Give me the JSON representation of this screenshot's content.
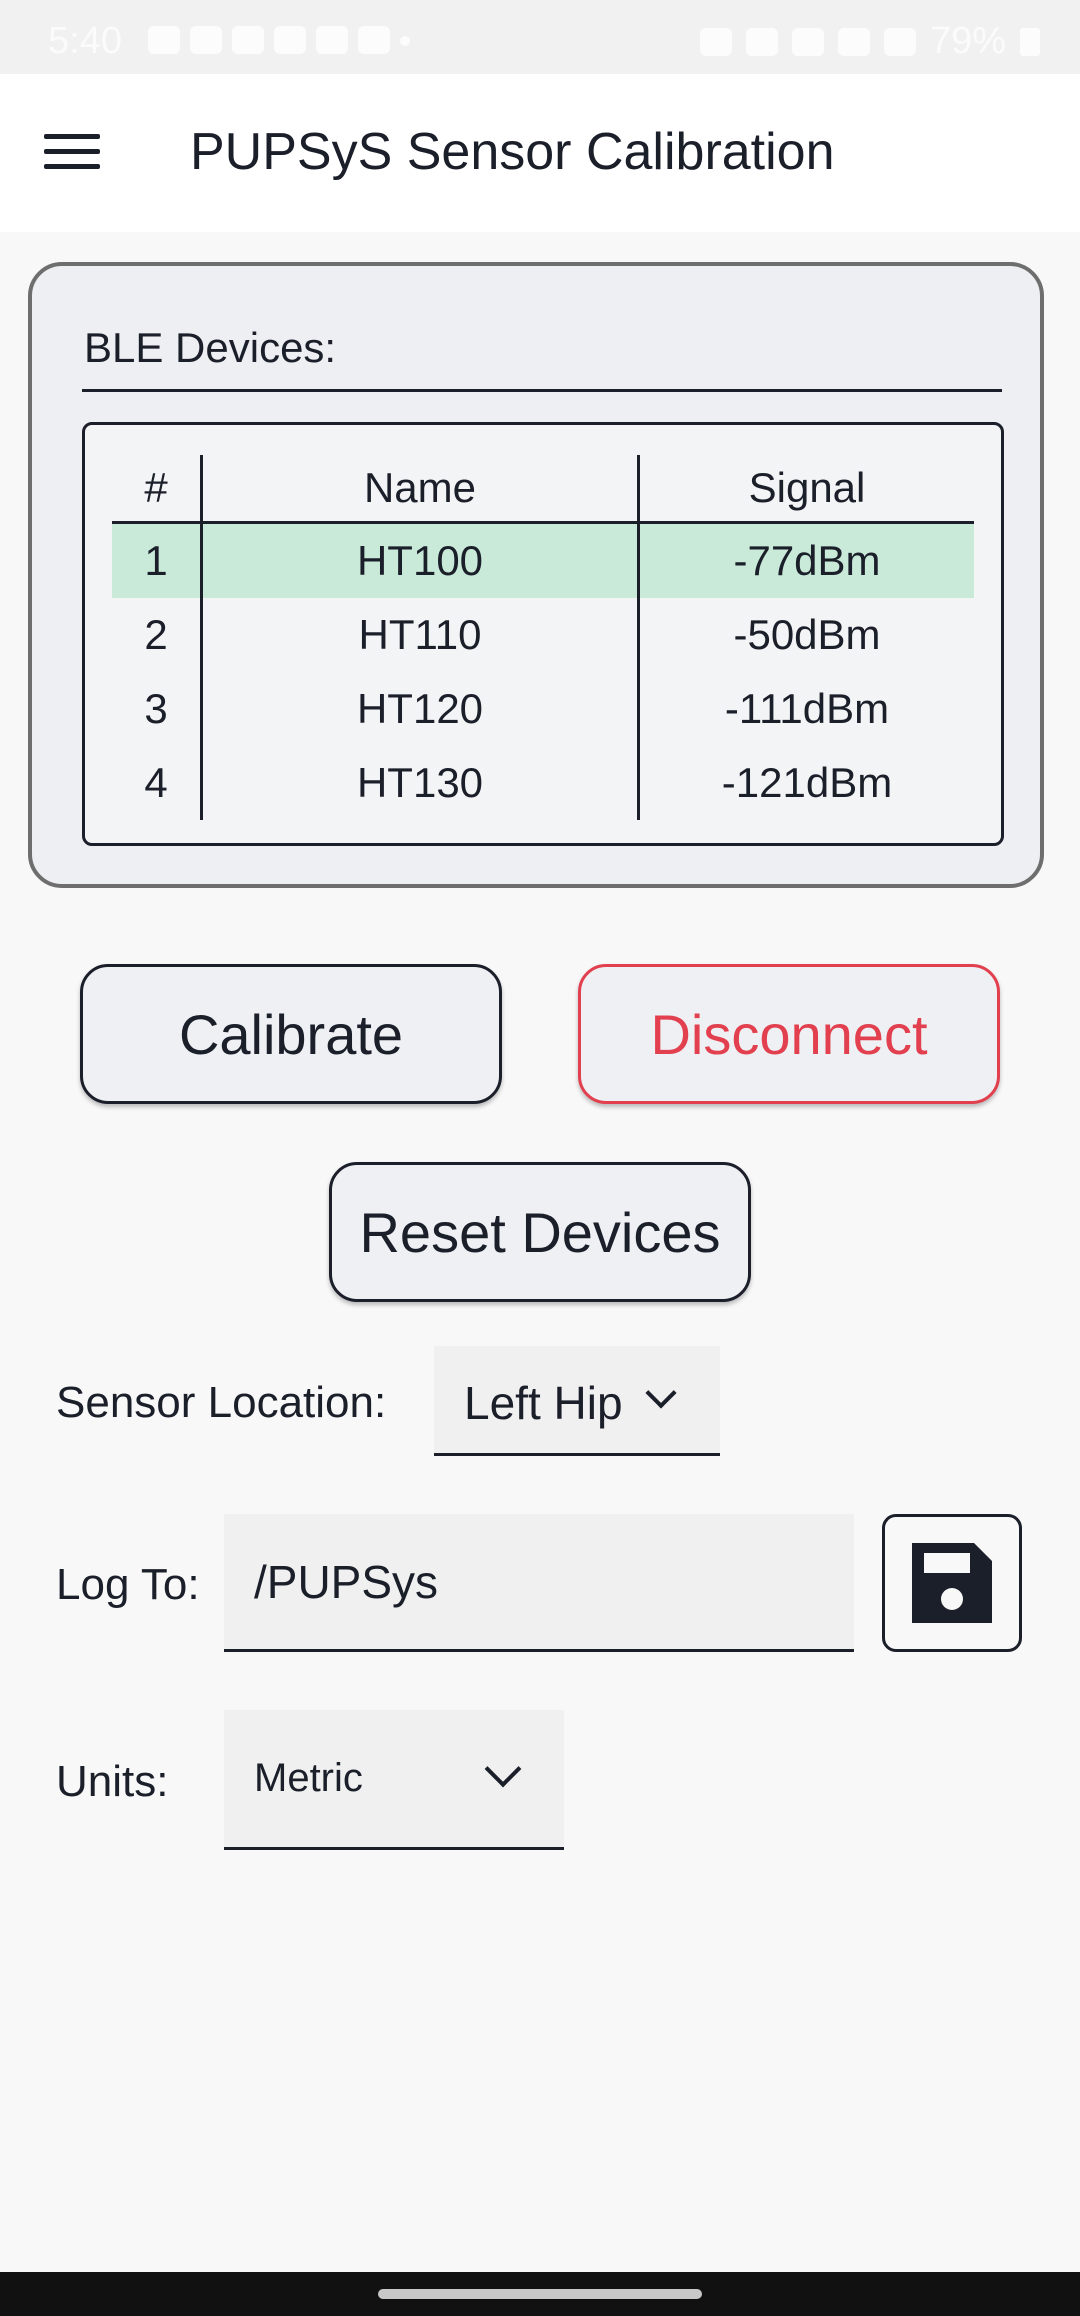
{
  "status_bar": {
    "time": "5:40",
    "battery": "79%"
  },
  "app_bar": {
    "title": "PUPSyS Sensor Calibration"
  },
  "ble": {
    "title": "BLE Devices:",
    "columns": [
      "#",
      "Name",
      "Signal"
    ],
    "rows": [
      {
        "num": "1",
        "name": "HT100",
        "signal": "-77dBm",
        "selected": true
      },
      {
        "num": "2",
        "name": "HT110",
        "signal": "-50dBm",
        "selected": false
      },
      {
        "num": "3",
        "name": "HT120",
        "signal": "-111dBm",
        "selected": false
      },
      {
        "num": "4",
        "name": "HT130",
        "signal": "-121dBm",
        "selected": false
      }
    ]
  },
  "buttons": {
    "calibrate": "Calibrate",
    "disconnect": "Disconnect",
    "reset": "Reset Devices"
  },
  "sensor_location": {
    "label": "Sensor Location:",
    "value": "Left Hip"
  },
  "log_to": {
    "label": "Log To:",
    "value": "/PUPSys"
  },
  "units": {
    "label": "Units:",
    "value": "Metric"
  },
  "colors": {
    "selected_row": "#c9ead9",
    "disconnect": "#e2404e",
    "text": "#1b1f2a"
  },
  "icons": {
    "menu": "hamburger-menu-icon",
    "save": "floppy-disk-icon",
    "dropdown": "chevron-down-icon"
  }
}
